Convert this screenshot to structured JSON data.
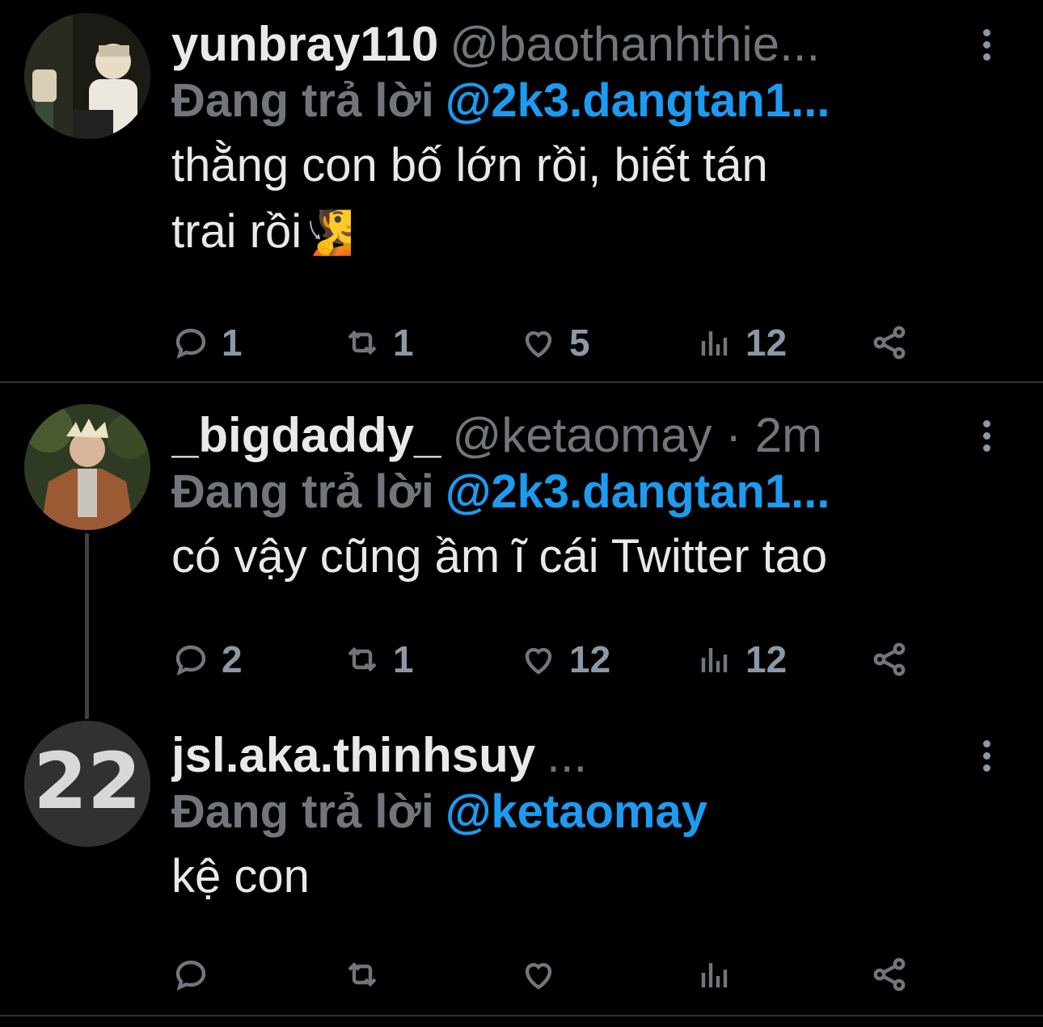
{
  "tweets": [
    {
      "display_name": "yunbray110",
      "handle": "@baothanhthie...",
      "reply_prefix": "Đang trả lời",
      "reply_to": "@2k3.dangtan1...",
      "text_line1": "thằng con bố lớn rồi, biết tán",
      "text_line2": "trai rồi",
      "emoji": "🧏",
      "replies": "1",
      "reposts": "1",
      "likes": "5",
      "views": "12"
    },
    {
      "display_name": "_bigdaddy_",
      "handle": "@ketaomay · 2m",
      "reply_prefix": "Đang trả lời",
      "reply_to": "@2k3.dangtan1...",
      "text_line1": "có vậy cũng ầm ĩ cái Twitter tao",
      "replies": "2",
      "reposts": "1",
      "likes": "12",
      "views": "12"
    },
    {
      "display_name": "jsl.aka.thinhsuy",
      "handle": "...",
      "reply_prefix": "Đang trả lời",
      "reply_to": "@ketaomay",
      "text_line1": "kệ con",
      "replies": "",
      "reposts": "",
      "likes": "",
      "views": ""
    }
  ],
  "icons": [
    "reply-icon",
    "repost-icon",
    "like-icon",
    "views-icon",
    "share-icon",
    "more-icon"
  ],
  "colors": {
    "background": "#000000",
    "text": "#e7e9ea",
    "muted": "#71767b",
    "link": "#1d9bf0"
  }
}
